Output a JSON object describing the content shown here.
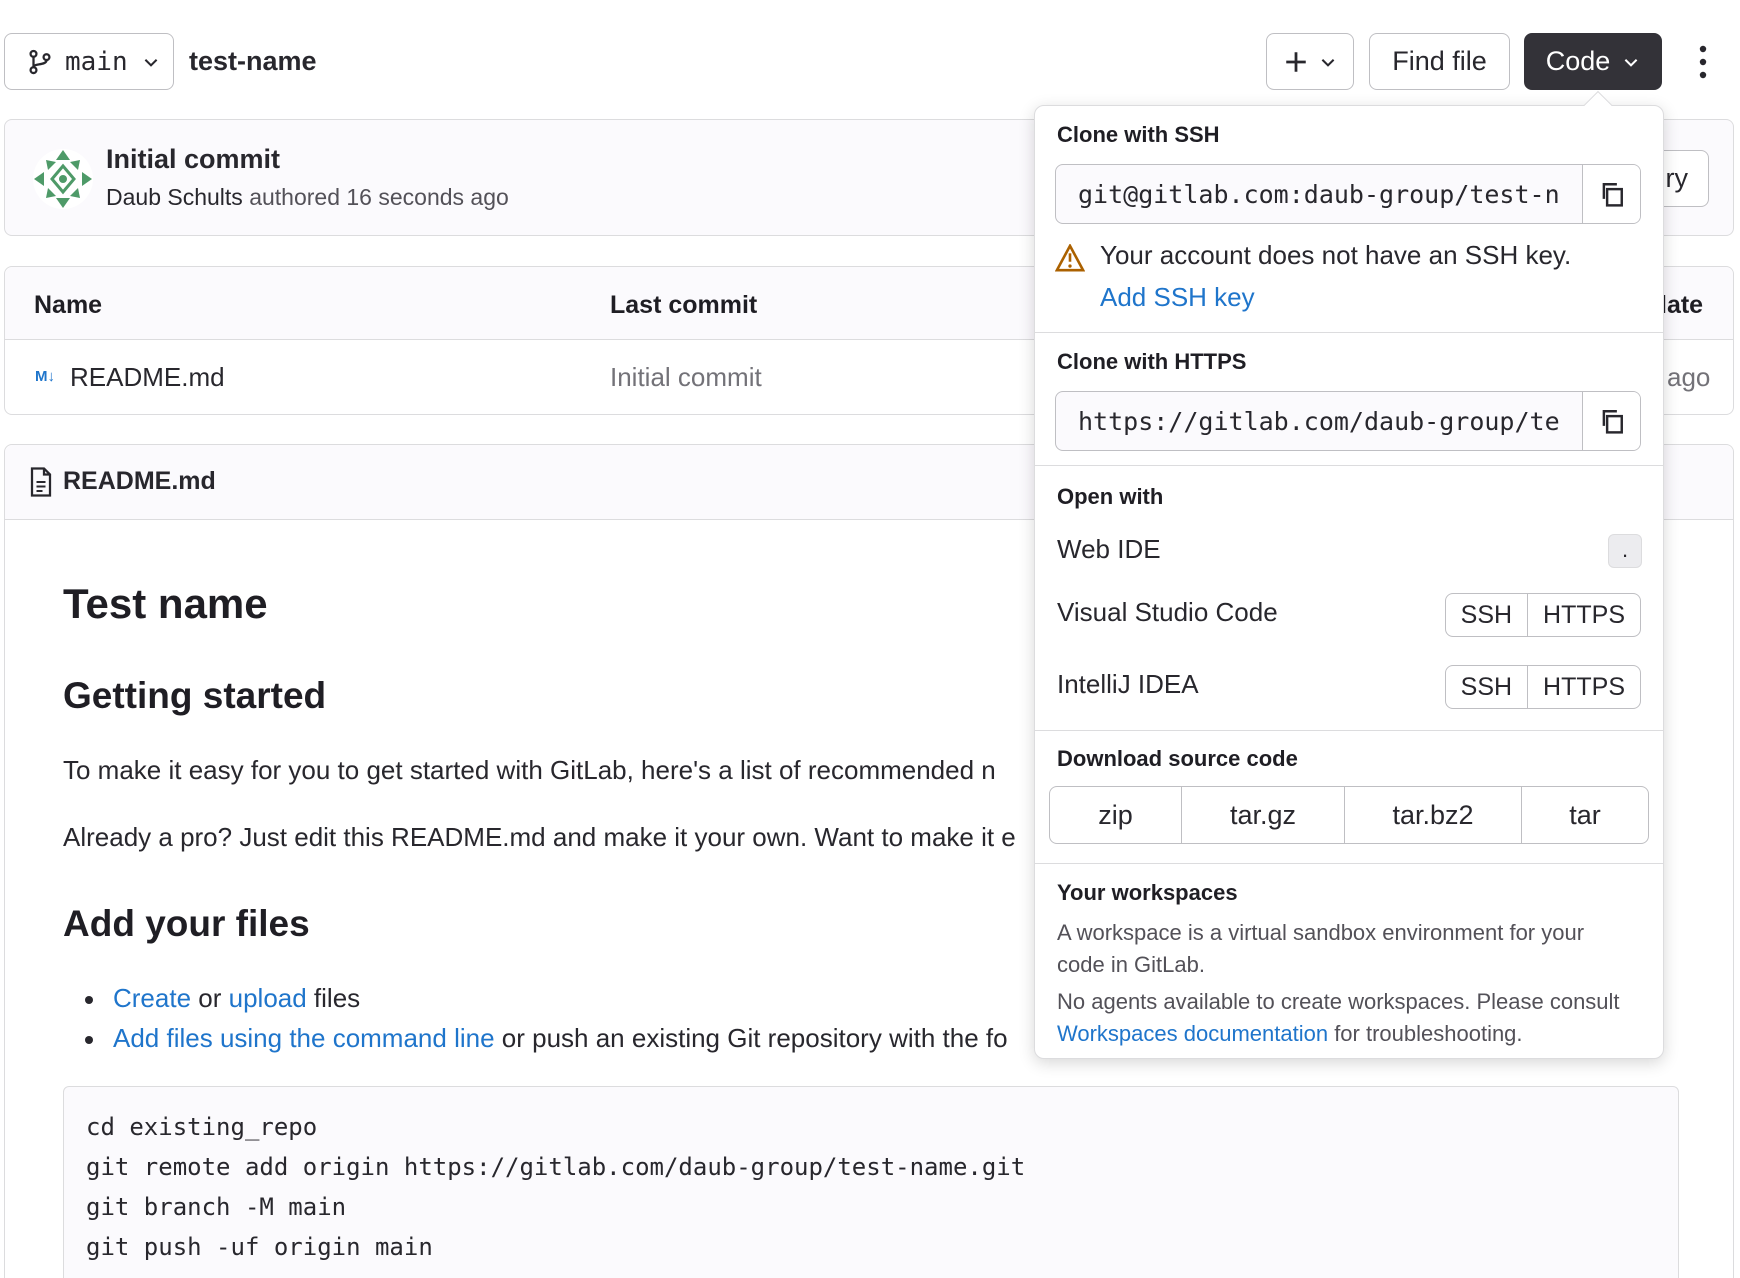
{
  "toolbar": {
    "branch": "main",
    "project": "test-name",
    "find_file": "Find file",
    "code": "Code"
  },
  "commit": {
    "title": "Initial commit",
    "author": "Daub Schults",
    "meta": "authored 16 seconds ago",
    "right_stub": "ry"
  },
  "file_table": {
    "headers": [
      "Name",
      "Last commit",
      "late"
    ],
    "rows": [
      {
        "name": "README.md",
        "last_commit": "Initial commit",
        "date_stub": "ago"
      }
    ]
  },
  "readme": {
    "header": "README.md",
    "h1": "Test name",
    "h2_getting_started": "Getting started",
    "p1": "To make it easy for you to get started with GitLab, here's a list of recommended n",
    "p2": "Already a pro? Just edit this README.md and make it your own. Want to make it e",
    "h2_add_files": "Add your files",
    "bullet1": {
      "link1": "Create",
      "mid": " or ",
      "link2": "upload",
      "tail": " files"
    },
    "bullet2": {
      "link": "Add files using the command line",
      "tail": " or push an existing Git repository with the fo"
    },
    "code_lines": [
      "cd existing_repo",
      "git remote add origin https://gitlab.com/daub-group/test-name.git",
      "git branch -M main",
      "git push -uf origin main"
    ]
  },
  "dropdown": {
    "ssh_title": "Clone with SSH",
    "ssh_url": "git@gitlab.com:daub-group/test-n",
    "ssh_warning": "Your account does not have an SSH key.",
    "add_ssh_key": "Add SSH key",
    "https_title": "Clone with HTTPS",
    "https_url": "https://gitlab.com/daub-group/te",
    "open_with_title": "Open with",
    "web_ide": "Web IDE",
    "web_ide_shortcut": ".",
    "vscode": "Visual Studio Code",
    "intellij": "IntelliJ IDEA",
    "ssh": "SSH",
    "https": "HTTPS",
    "download_title": "Download source code",
    "downloads": [
      "zip",
      "tar.gz",
      "tar.bz2",
      "tar"
    ],
    "workspaces_title": "Your workspaces",
    "workspaces_desc": "A workspace is a virtual sandbox environment for your code in GitLab.",
    "workspaces_note_pre": "No agents available to create workspaces. Please consult ",
    "workspaces_link": "Workspaces documentation",
    "workspaces_note_post": " for troubleshooting."
  },
  "colors": {
    "link": "#1f75cb",
    "dark_button": "#333238",
    "warning": "#ab6100"
  }
}
